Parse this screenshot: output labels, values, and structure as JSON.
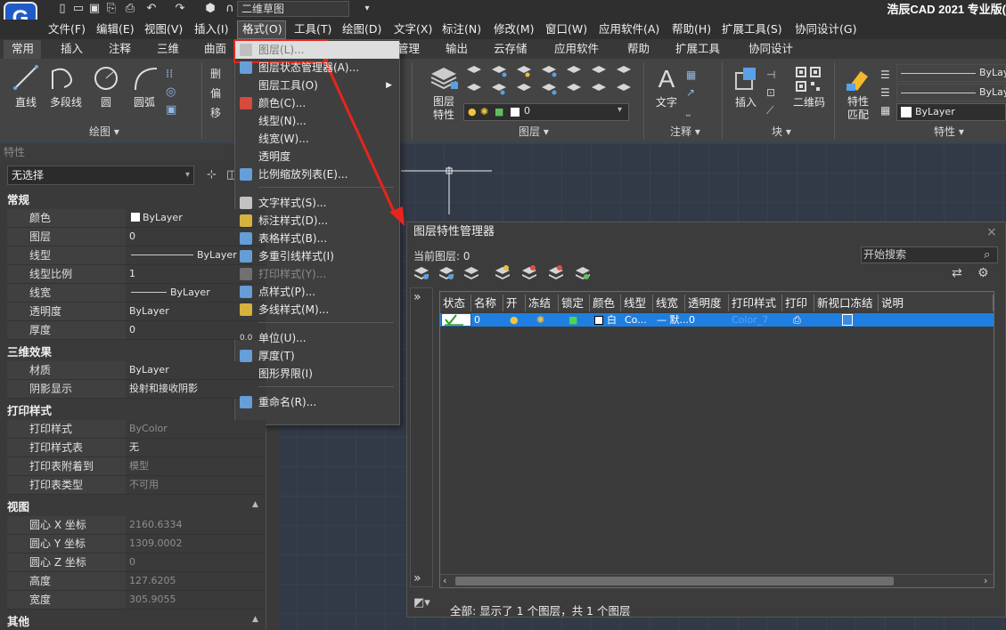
{
  "app": {
    "title": "浩辰CAD 2021 专业版(",
    "logo": "G",
    "workspace": "二维草图"
  },
  "menu": [
    "文件(F)",
    "编辑(E)",
    "视图(V)",
    "插入(I)",
    "格式(O)",
    "工具(T)",
    "绘图(D)",
    "文字(X)",
    "标注(N)",
    "修改(M)",
    "窗口(W)",
    "应用软件(A)",
    "帮助(H)",
    "扩展工具(S)",
    "协同设计(G)"
  ],
  "ribbon_tabs": [
    "常用",
    "插入",
    "注释",
    "三维",
    "曲面",
    "管理",
    "输出",
    "云存储",
    "应用软件",
    "帮助",
    "扩展工具",
    "协同设计"
  ],
  "ribbon": {
    "draw": {
      "line": "直线",
      "polyline": "多段线",
      "circle": "圆",
      "arc": "圆弧",
      "label": "绘图"
    },
    "modify_partial": [
      "删",
      "偏",
      "移"
    ],
    "layer": {
      "props": "图层\n特性",
      "props_l1": "图层",
      "props_l2": "特性",
      "current": "0",
      "label": "图层"
    },
    "annotation": {
      "text": "文字",
      "label": "注释"
    },
    "block": {
      "insert": "插入",
      "qr": "二维码",
      "label": "块"
    },
    "properties": {
      "match_l1": "特性",
      "match_l2": "匹配",
      "color": "ByLayer",
      "linetype": "ByLaye",
      "lineweight": "ByLaye",
      "label": "特性"
    }
  },
  "properties_panel": {
    "header": "特性",
    "selection": "无选择",
    "sections": [
      {
        "title": "常规",
        "rows": [
          [
            "颜色",
            "ByLayer"
          ],
          [
            "图层",
            "0"
          ],
          [
            "线型",
            "ByLayer"
          ],
          [
            "线型比例",
            "1"
          ],
          [
            "线宽",
            "ByLayer"
          ],
          [
            "透明度",
            "ByLayer"
          ],
          [
            "厚度",
            "0"
          ]
        ]
      },
      {
        "title": "三维效果",
        "rows": [
          [
            "材质",
            "ByLayer"
          ],
          [
            "阴影显示",
            "投射和接收阴影"
          ]
        ]
      },
      {
        "title": "打印样式",
        "rows": [
          [
            "打印样式",
            "ByColor"
          ],
          [
            "打印样式表",
            "无"
          ],
          [
            "打印表附着到",
            "模型"
          ],
          [
            "打印表类型",
            "不可用"
          ]
        ]
      },
      {
        "title": "视图",
        "rows": [
          [
            "圆心 X 坐标",
            "2160.6334"
          ],
          [
            "圆心 Y 坐标",
            "1309.0002"
          ],
          [
            "圆心 Z 坐标",
            "0"
          ],
          [
            "高度",
            "127.6205"
          ],
          [
            "宽度",
            "305.9055"
          ]
        ]
      },
      {
        "title": "其他",
        "rows": []
      }
    ]
  },
  "format_menu": [
    {
      "label": "图层(L)...",
      "icon": "layer-icon",
      "state": "highlight"
    },
    {
      "label": "图层状态管理器(A)...",
      "icon": "layer-state-icon"
    },
    {
      "label": "图层工具(O)",
      "icon": "",
      "submenu": true
    },
    {
      "label": "颜色(C)...",
      "icon": "color-icon"
    },
    {
      "label": "线型(N)...",
      "icon": ""
    },
    {
      "label": "线宽(W)...",
      "icon": ""
    },
    {
      "label": "透明度",
      "icon": ""
    },
    {
      "label": "比例缩放列表(E)...",
      "icon": "scale-list-icon"
    },
    {
      "sep": true
    },
    {
      "label": "文字样式(S)...",
      "icon": "text-style-icon"
    },
    {
      "label": "标注样式(D)...",
      "icon": "dim-style-icon"
    },
    {
      "label": "表格样式(B)...",
      "icon": "table-style-icon"
    },
    {
      "label": "多重引线样式(I)",
      "icon": "mleader-style-icon"
    },
    {
      "label": "打印样式(Y)...",
      "icon": "plot-style-icon",
      "state": "disabled"
    },
    {
      "label": "点样式(P)...",
      "icon": "point-style-icon"
    },
    {
      "label": "多线样式(M)...",
      "icon": "mline-style-icon"
    },
    {
      "sep": true
    },
    {
      "label": "单位(U)...",
      "icon": "units-icon",
      "icon_text": "0.0"
    },
    {
      "label": "厚度(T)",
      "icon": "thickness-icon"
    },
    {
      "label": "图形界限(I)",
      "icon": ""
    },
    {
      "sep": true
    },
    {
      "label": "重命名(R)...",
      "icon": "rename-icon"
    }
  ],
  "layer_dialog": {
    "title": "图层特性管理器",
    "close": "×",
    "current_layer": "当前图层: 0",
    "search_placeholder": "开始搜索",
    "columns": [
      "状态",
      "名称",
      "开",
      "冻结",
      "锁定",
      "颜色",
      "线型",
      "线宽",
      "透明度",
      "打印样式",
      "打印",
      "新视口冻结",
      "说明"
    ],
    "rows": [
      {
        "name": "0",
        "color": "白",
        "linetype": "Co...",
        "lineweight": "— 默...",
        "transparency": "0",
        "plotstyle": "Color_7"
      }
    ],
    "expand": "»",
    "status": "全部: 显示了 1 个图层，共 1 个图层"
  },
  "colors": {
    "accent": "#1f7fe0",
    "highlight_border": "#e8241c",
    "arrow": "#e8241c"
  }
}
